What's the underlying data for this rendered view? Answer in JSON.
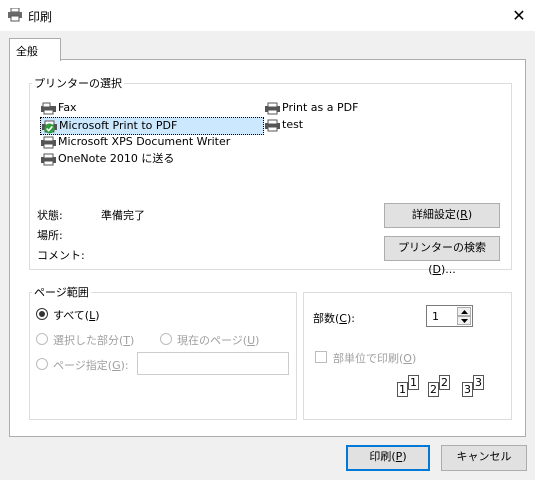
{
  "window": {
    "title": "印刷",
    "close_glyph": "✕"
  },
  "tab": {
    "label": "全般"
  },
  "printer_select": {
    "legend": "プリンターの選択",
    "printers_col1": [
      {
        "name": "Fax",
        "icon": "fax-printer-icon",
        "selected": false,
        "default": false
      },
      {
        "name": "Microsoft Print to PDF",
        "icon": "printer-icon",
        "selected": true,
        "default": true
      },
      {
        "name": "Microsoft XPS Document Writer",
        "icon": "printer-icon",
        "selected": false,
        "default": false
      },
      {
        "name": "OneNote 2010 に送る",
        "icon": "printer-icon",
        "selected": false,
        "default": false
      }
    ],
    "printers_col2": [
      {
        "name": "Print as a PDF",
        "icon": "printer-icon"
      },
      {
        "name": "test",
        "icon": "printer-icon"
      }
    ],
    "status_label": "状態:",
    "status_value": "準備完了",
    "location_label": "場所:",
    "comment_label": "コメント:",
    "details_button": {
      "text": "詳細設定(",
      "key": "R",
      "end": ")"
    },
    "find_button": {
      "text": "プリンターの検索(",
      "key": "D",
      "end": ")..."
    }
  },
  "page_range": {
    "legend": "ページ範囲",
    "all": {
      "text": "すべて(",
      "key": "L",
      "end": ")",
      "checked": true
    },
    "selection": {
      "text": "選択した部分(",
      "key": "T",
      "end": ")",
      "checked": false
    },
    "current": {
      "text": "現在のページ(",
      "key": "U",
      "end": ")",
      "checked": false
    },
    "pages": {
      "text": "ページ指定(",
      "key": "G",
      "end": "):",
      "checked": false
    },
    "pages_value": ""
  },
  "copies": {
    "label_text": "部数(",
    "label_key": "C",
    "label_end": "):",
    "value": "1",
    "collate": {
      "text": "部単位で印刷(",
      "key": "O",
      "end": ")",
      "checked": false
    },
    "collate_pages": [
      "1",
      "1",
      "2",
      "2",
      "3",
      "3"
    ]
  },
  "footer": {
    "print_button": {
      "text": "印刷(",
      "key": "P",
      "end": ")"
    },
    "cancel_button": "キャンセル"
  },
  "colors": {
    "selection": "#cce8ff",
    "accent": "#0078d7",
    "disabled": "#a0a0a0",
    "check_green": "#2e9e3a"
  }
}
